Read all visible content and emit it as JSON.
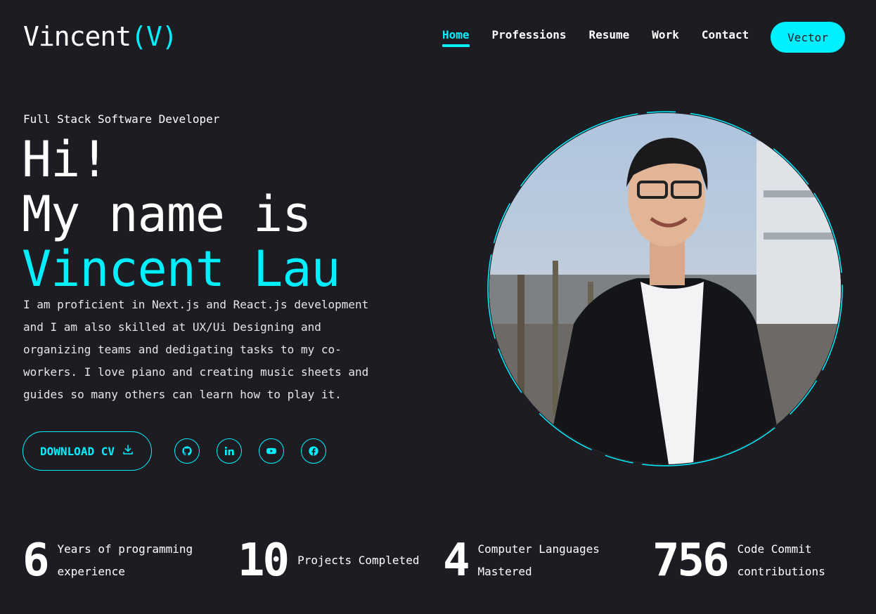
{
  "header": {
    "logo_text": "Vincent",
    "logo_accent": "(V)",
    "nav": [
      {
        "label": "Home",
        "active": true
      },
      {
        "label": "Professions",
        "active": false
      },
      {
        "label": "Resume",
        "active": false
      },
      {
        "label": "Work",
        "active": false
      },
      {
        "label": "Contact",
        "active": false
      }
    ],
    "cta_label": "Vector"
  },
  "hero": {
    "subtitle": "Full Stack Software Developer",
    "greeting_line1": "Hi!",
    "greeting_line2": "My name is",
    "name": "Vincent Lau",
    "bio": "I am proficient in Next.js and React.js development and I am also skilled at UX/Ui Designing and organizing teams and dedigating tasks to my co-workers. I love piano and creating music sheets and guides so many others can learn how to play it.",
    "download_label": "Download CV",
    "socials": [
      {
        "icon": "github-icon"
      },
      {
        "icon": "linkedin-icon"
      },
      {
        "icon": "youtube-icon"
      },
      {
        "icon": "facebook-icon"
      }
    ]
  },
  "stats": [
    {
      "value": "6",
      "label": "Years of programming experience"
    },
    {
      "value": "10",
      "label": "Projects Completed"
    },
    {
      "value": "4",
      "label": "Computer Languages Mastered"
    },
    {
      "value": "756",
      "label": "Code Commit contributions"
    }
  ],
  "colors": {
    "accent": "#00f0ff",
    "background": "#1d1c22",
    "text": "#ffffff"
  }
}
